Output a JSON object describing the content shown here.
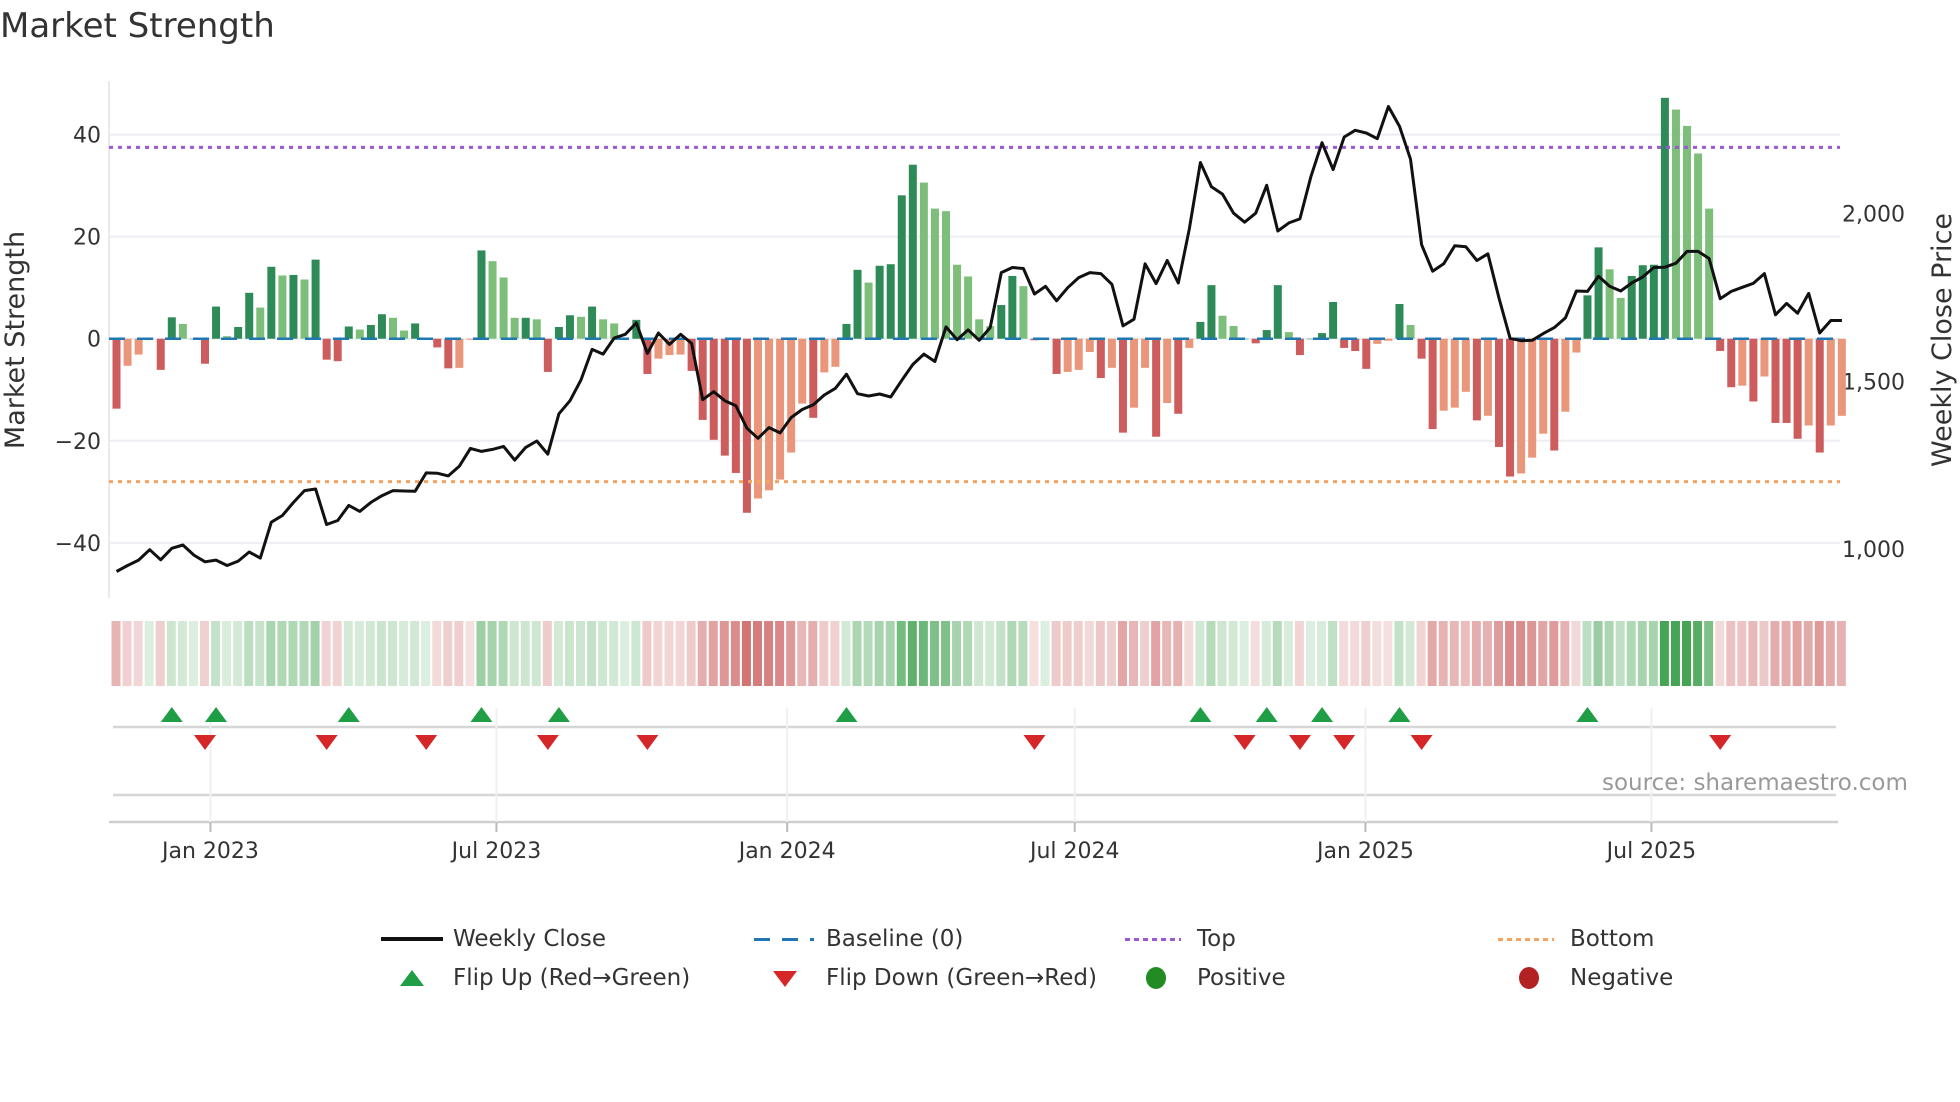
{
  "title": "Market Strength",
  "source_label": "source: sharemaestro.com",
  "colors": {
    "strong_positive": "#2e8b57",
    "weak_positive": "#7dbf7a",
    "strong_negative": "#cd5c5c",
    "weak_negative": "#e9967a",
    "baseline": "#1f77b4",
    "top": "#9b59d6",
    "bottom": "#f4a460",
    "flip_up": "#1f9e45",
    "flip_down": "#d62728",
    "positive": "#228b22",
    "negative": "#b22222",
    "close": "#111111"
  },
  "chart_data": {
    "type": "bar+line",
    "title": "Market Strength",
    "ylabel": "Market Strength",
    "y2label": "Weekly Close Price",
    "ylim": [
      -50.8,
      50.5
    ],
    "y2lim": [
      854,
      2395
    ],
    "yticks": [
      "40",
      "20",
      "0",
      "−20",
      "−40"
    ],
    "ytick_values": [
      40,
      20,
      0,
      -20,
      -40
    ],
    "y2ticks": [
      "2,000",
      "1,500",
      "1,000"
    ],
    "y2tick_values": [
      2000,
      1500,
      1000
    ],
    "xticks": [
      {
        "label": "Jan 2023",
        "date": "2023-01-01"
      },
      {
        "label": "Jul 2023",
        "date": "2023-07-01"
      },
      {
        "label": "Jan 2024",
        "date": "2024-01-01"
      },
      {
        "label": "Jul 2024",
        "date": "2024-07-01"
      },
      {
        "label": "Jan 2025",
        "date": "2025-01-01"
      },
      {
        "label": "Jul 2025",
        "date": "2025-07-01"
      }
    ],
    "first_week": "2022-10-31",
    "frequency": "weekly",
    "top_level": 37.5,
    "bottom_level": -28,
    "baseline": 0,
    "strength": [
      -13.7,
      -5.3,
      -3.1,
      0,
      -6.1,
      4.2,
      2.9,
      0,
      -4.9,
      6.3,
      0.5,
      2.3,
      9.0,
      6.1,
      14.1,
      12.4,
      12.5,
      11.6,
      15.5,
      -4.1,
      -4.4,
      2.4,
      1.8,
      2.7,
      4.8,
      4.1,
      1.6,
      3.0,
      0,
      -1.7,
      -5.8,
      -5.7,
      -0.2,
      17.3,
      15.2,
      12.0,
      4.1,
      4.1,
      3.8,
      -6.5,
      2.3,
      4.6,
      4.3,
      6.3,
      3.8,
      3.0,
      0,
      3.7,
      -6.9,
      -3.9,
      -3.2,
      -3.1,
      -6.3,
      -15.9,
      -19.8,
      -22.9,
      -26.3,
      -34.1,
      -31.3,
      -29.7,
      -27.6,
      -22.3,
      -12.7,
      -15.5,
      -6.6,
      -5.5,
      2.9,
      13.5,
      11.0,
      14.3,
      14.6,
      28.1,
      34.1,
      30.6,
      25.5,
      25.0,
      14.5,
      12.2,
      3.8,
      2.5,
      6.6,
      12.3,
      10.3,
      -0.3,
      0,
      -6.9,
      -6.5,
      -6.1,
      -2.6,
      -7.7,
      -5.7,
      -18.4,
      -13.5,
      -5.7,
      -19.2,
      -12.6,
      -14.7,
      -1.8,
      3.3,
      10.5,
      4.5,
      2.5,
      0,
      -0.9,
      1.7,
      10.5,
      1.3,
      -3.2,
      0,
      1.1,
      7.2,
      -1.8,
      -2.4,
      -5.9,
      -1.0,
      -0.4,
      6.8,
      2.7,
      -3.9,
      -17.7,
      -14.1,
      -13.5,
      -10.4,
      -16.0,
      -15.1,
      -21.2,
      -27.0,
      -26.4,
      -23.3,
      -18.6,
      -21.9,
      -14.3,
      -2.7,
      8.5,
      17.9,
      13.6,
      8.0,
      12.3,
      14.4,
      14.5,
      47.2,
      44.9,
      41.7,
      36.3,
      25.5,
      -2.4,
      -9.5,
      -9.2,
      -12.3,
      -7.4,
      -16.5,
      -16.5,
      -19.6,
      -17.0,
      -22.3,
      -17.0,
      -15.1
    ],
    "weekly_close": [
      933,
      951,
      967,
      998,
      968,
      1002,
      1012,
      982,
      962,
      967,
      951,
      964,
      991,
      973,
      1080,
      1100,
      1139,
      1174,
      1179,
      1073,
      1085,
      1130,
      1112,
      1139,
      1159,
      1174,
      1173,
      1172,
      1227,
      1226,
      1218,
      1247,
      1300,
      1291,
      1297,
      1306,
      1265,
      1303,
      1322,
      1283,
      1403,
      1442,
      1504,
      1595,
      1581,
      1629,
      1640,
      1674,
      1583,
      1644,
      1610,
      1640,
      1613,
      1445,
      1469,
      1442,
      1427,
      1360,
      1330,
      1362,
      1346,
      1392,
      1416,
      1430,
      1459,
      1479,
      1521,
      1463,
      1456,
      1462,
      1453,
      1503,
      1550,
      1581,
      1559,
      1662,
      1624,
      1653,
      1622,
      1660,
      1824,
      1839,
      1836,
      1760,
      1783,
      1740,
      1779,
      1809,
      1824,
      1821,
      1789,
      1665,
      1685,
      1850,
      1791,
      1860,
      1793,
      1954,
      2152,
      2080,
      2058,
      2001,
      1974,
      2001,
      2084,
      1948,
      1972,
      1984,
      2111,
      2211,
      2131,
      2228,
      2248,
      2240,
      2223,
      2319,
      2260,
      2162,
      1907,
      1828,
      1850,
      1904,
      1901,
      1860,
      1880,
      1748,
      1628,
      1621,
      1622,
      1642,
      1660,
      1689,
      1769,
      1768,
      1813,
      1783,
      1769,
      1793,
      1811,
      1839,
      1840,
      1852,
      1887,
      1887,
      1866,
      1746,
      1768,
      1780,
      1792,
      1821,
      1698,
      1732,
      1703,
      1762,
      1644,
      1681,
      1681
    ],
    "flip_up_weeks": [
      5,
      9,
      21,
      33,
      40,
      66,
      98,
      104,
      109,
      116,
      133
    ],
    "flip_down_weeks": [
      8,
      19,
      28,
      39,
      48,
      83,
      102,
      107,
      111,
      118,
      145
    ],
    "legend": [
      {
        "key": "close",
        "label": "Weekly Close"
      },
      {
        "key": "baseline",
        "label": "Baseline (0)"
      },
      {
        "key": "top",
        "label": "Top"
      },
      {
        "key": "bottom",
        "label": "Bottom"
      },
      {
        "key": "flip_up",
        "label": "Flip Up (Red→Green)"
      },
      {
        "key": "flip_down",
        "label": "Flip Down (Green→Red)"
      },
      {
        "key": "positive",
        "label": "Positive"
      },
      {
        "key": "negative",
        "label": "Negative"
      }
    ],
    "legend_placement": "bottom"
  }
}
